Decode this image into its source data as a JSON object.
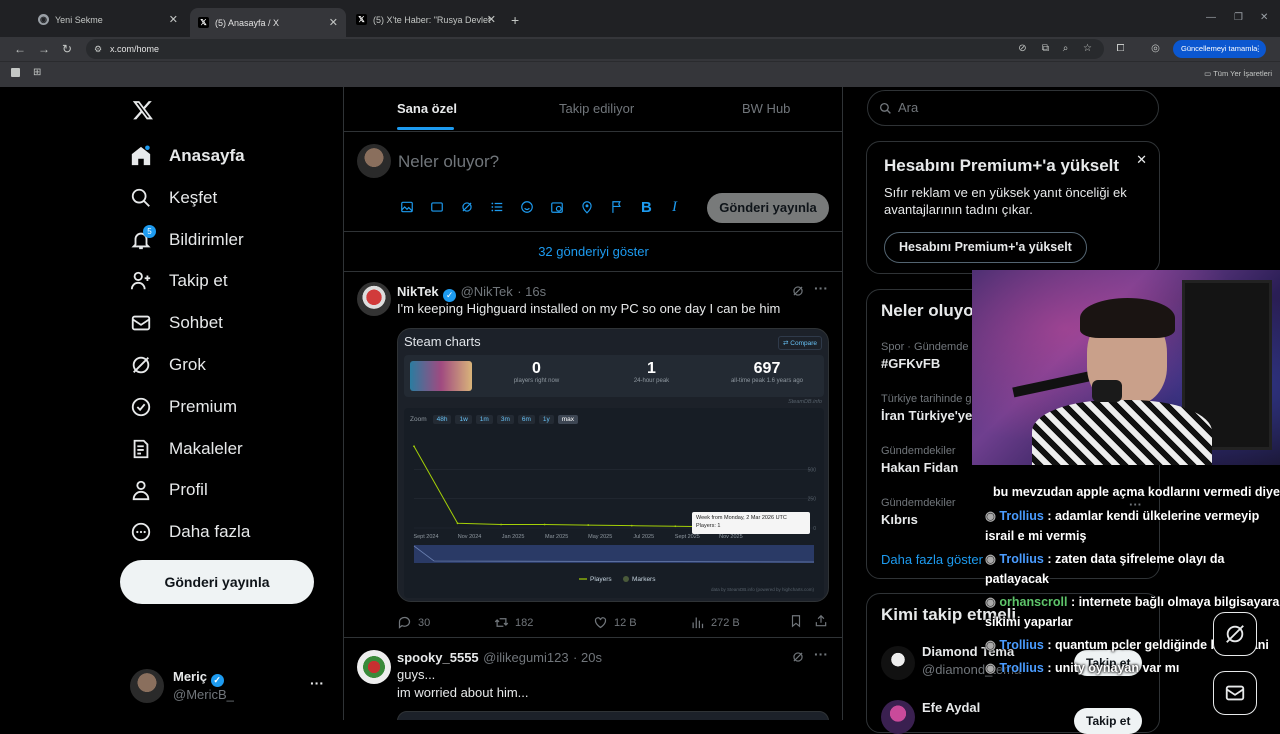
{
  "browser": {
    "tabs": [
      {
        "title": "Yeni Sekme"
      },
      {
        "title": "(5) Anasayfa / X"
      },
      {
        "title": "(5) X'te Haber: \"Rusya Devlet Ba"
      }
    ],
    "url": "x.com/home",
    "update_button": "Güncellemeyi tamamla",
    "bookmarks_all": "Tüm Yer İşaretleri"
  },
  "nav": {
    "items": [
      {
        "label": "Anasayfa",
        "icon": "home-icon"
      },
      {
        "label": "Keşfet",
        "icon": "search-icon"
      },
      {
        "label": "Bildirimler",
        "icon": "bell-icon",
        "badge": "5"
      },
      {
        "label": "Takip et",
        "icon": "follow-icon"
      },
      {
        "label": "Sohbet",
        "icon": "mail-icon"
      },
      {
        "label": "Grok",
        "icon": "grok-icon"
      },
      {
        "label": "Premium",
        "icon": "premium-icon"
      },
      {
        "label": "Makaleler",
        "icon": "articles-icon"
      },
      {
        "label": "Profil",
        "icon": "profile-icon"
      },
      {
        "label": "Daha fazla",
        "icon": "more-icon"
      }
    ],
    "post_button": "Gönderi yayınla",
    "profile": {
      "name": "Meriç",
      "handle": "@MericB_"
    }
  },
  "main": {
    "tabs": [
      "Sana özel",
      "Takip ediliyor",
      "BW Hub"
    ],
    "compose_placeholder": "Neler oluyor?",
    "compose_button": "Gönderi yayınla",
    "show_more": "32 gönderiyi göster",
    "tweets": [
      {
        "name": "NikTek",
        "handle": "@NikTek",
        "time": "· 16s",
        "text": "I'm keeping Highguard installed on my PC so one day I can be him",
        "card": {
          "title": "Steam charts",
          "compare": "Compare",
          "stats": [
            {
              "value": "0",
              "label": "players right now"
            },
            {
              "value": "1",
              "label": "24-hour peak"
            },
            {
              "value": "697",
              "label": "all-time peak 1.6 years ago"
            }
          ],
          "source_tag": "SteamDB.info",
          "zoom_label": "Zoom",
          "zoom_options": [
            "48h",
            "1w",
            "1m",
            "3m",
            "6m",
            "1y",
            "max"
          ],
          "tooltip_title": "Week from Monday, 2 Mar 2026 UTC",
          "tooltip_value": "Players: 1",
          "legend": [
            "Players",
            "Markers"
          ],
          "credit": "data by SteamDB.info (powered by highcharts.com)"
        },
        "replies": "30",
        "retweets": "182",
        "likes": "12 B",
        "views": "272 B"
      },
      {
        "name": "spooky_5555",
        "handle": "@ilikegumi123",
        "time": "· 20s",
        "line1": "guys...",
        "line2": "im worried about him..."
      }
    ]
  },
  "chart_data": {
    "type": "line",
    "title": "",
    "x": [
      "Sept 2024",
      "Nov 2024",
      "Jan 2025",
      "Mar 2025",
      "May 2025",
      "Jul 2025",
      "Sept 2025",
      "Nov 2025",
      "Jan 2026",
      "Mar 2026"
    ],
    "series": [
      {
        "name": "Players",
        "values": [
          697,
          40,
          30,
          30,
          25,
          20,
          15,
          10,
          5,
          1
        ]
      }
    ],
    "yticks": [
      "500",
      "250",
      "0"
    ],
    "ylim": [
      0,
      750
    ],
    "legend": "bottom-center"
  },
  "sidebar": {
    "search_placeholder": "Ara",
    "premium": {
      "title": "Hesabını Premium+'a yükselt",
      "text": "Sıfır reklam ve en yüksek yanıt önceliği ek avantajlarının tadını çıkar.",
      "button": "Hesabını Premium+'a yükselt"
    },
    "trends_title": "Neler oluyo",
    "trends": [
      {
        "meta": "Spor · Gündemde",
        "name": "#GFKvFB"
      },
      {
        "meta": "Türkiye tarihinde g",
        "name": "İran Türkiye'ye"
      },
      {
        "meta": "Gündemdekiler",
        "name": "Hakan Fidan"
      },
      {
        "meta": "Gündemdekiler",
        "name": "Kıbrıs"
      }
    ],
    "show_more": "Daha fazla göster",
    "who_to_follow_title": "Kimi takip etmeli",
    "follow": [
      {
        "name": "Diamond Tema",
        "handle": "@diamond_tema",
        "button": "Takip et"
      },
      {
        "name": "Efe Aydal",
        "handle": "",
        "button": "Takip et"
      }
    ]
  },
  "chat": [
    {
      "user": "",
      "text": "bu mevzudan apple açma kodlarını vermedi diye"
    },
    {
      "user": "Trollius",
      "text": " : adamlar kendi ülkelerine vermeyip israil e mi vermiş"
    },
    {
      "user": "Trollius",
      "text": " : zaten data şifreleme olayı da patlayacak"
    },
    {
      "user": "orhanscroll",
      "text": " : internete bağlı olmaya bilgisayara sikimi yaparlar"
    },
    {
      "user": "Trollius",
      "text": " : quantum pcler geldiğinde bittik yani"
    },
    {
      "user": "Trollius",
      "text": " : unity oynayan var mı"
    }
  ]
}
